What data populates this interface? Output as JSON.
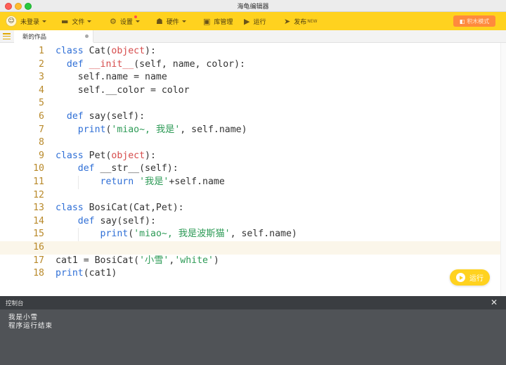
{
  "window": {
    "title": "海龟编辑器"
  },
  "toolbar": {
    "login": "未登录",
    "file": "文件",
    "settings": "设置",
    "hardware": "硬件",
    "library": "库管理",
    "run": "运行",
    "publish": "发布",
    "publish_badge": "NEW",
    "mode": "积木模式"
  },
  "tabs": [
    {
      "label": "新的作品"
    }
  ],
  "editor": {
    "line_numbers": [
      "1",
      "2",
      "3",
      "4",
      "5",
      "6",
      "7",
      "8",
      "9",
      "10",
      "11",
      "12",
      "13",
      "14",
      "15",
      "16",
      "17",
      "18"
    ],
    "active_line": 16,
    "lines": [
      [
        {
          "t": "class ",
          "c": "kw"
        },
        {
          "t": "Cat(",
          "c": ""
        },
        {
          "t": "object",
          "c": "bi"
        },
        {
          "t": "):",
          "c": ""
        }
      ],
      [
        {
          "t": "  ",
          "c": ""
        },
        {
          "t": "def ",
          "c": "kw"
        },
        {
          "t": "__init__",
          "c": "bi"
        },
        {
          "t": "(self, name, color):",
          "c": ""
        }
      ],
      [
        {
          "t": "    self.name = name",
          "c": ""
        }
      ],
      [
        {
          "t": "    self.__color = color",
          "c": ""
        }
      ],
      [],
      [
        {
          "t": "  ",
          "c": ""
        },
        {
          "t": "def ",
          "c": "kw"
        },
        {
          "t": "say(self):",
          "c": ""
        }
      ],
      [
        {
          "t": "    ",
          "c": ""
        },
        {
          "t": "print",
          "c": "kw"
        },
        {
          "t": "(",
          "c": ""
        },
        {
          "t": "'miao~, 我是'",
          "c": "st"
        },
        {
          "t": ", self.name)",
          "c": ""
        }
      ],
      [],
      [
        {
          "t": "class ",
          "c": "kw"
        },
        {
          "t": "Pet(",
          "c": ""
        },
        {
          "t": "object",
          "c": "bi"
        },
        {
          "t": "):",
          "c": ""
        }
      ],
      [
        {
          "t": "    ",
          "c": ""
        },
        {
          "t": "def ",
          "c": "kw"
        },
        {
          "t": "__str__(self):",
          "c": ""
        }
      ],
      [
        {
          "t": "        ",
          "c": ""
        },
        {
          "t": "return ",
          "c": "kw"
        },
        {
          "t": "'我是'",
          "c": "st"
        },
        {
          "t": "+self.name",
          "c": ""
        }
      ],
      [],
      [
        {
          "t": "class ",
          "c": "kw"
        },
        {
          "t": "BosiCat(Cat,Pet):",
          "c": ""
        }
      ],
      [
        {
          "t": "    ",
          "c": ""
        },
        {
          "t": "def ",
          "c": "kw"
        },
        {
          "t": "say(self):",
          "c": ""
        }
      ],
      [
        {
          "t": "        ",
          "c": ""
        },
        {
          "t": "print",
          "c": "kw"
        },
        {
          "t": "(",
          "c": ""
        },
        {
          "t": "'miao~, 我是波斯猫'",
          "c": "st"
        },
        {
          "t": ", self.name)",
          "c": ""
        }
      ],
      [],
      [
        {
          "t": "cat1 = BosiCat(",
          "c": ""
        },
        {
          "t": "'小雪'",
          "c": "st"
        },
        {
          "t": ",",
          "c": ""
        },
        {
          "t": "'white'",
          "c": "st"
        },
        {
          "t": ")",
          "c": ""
        }
      ],
      [
        {
          "t": "print",
          "c": "kw"
        },
        {
          "t": "(cat1)",
          "c": ""
        }
      ]
    ],
    "run_button": "运行"
  },
  "console": {
    "title": "控制台",
    "close_icon": "close-icon",
    "output": [
      "我是小雪",
      "程序运行结束"
    ]
  },
  "colors": {
    "accent": "#ffd21f",
    "mode_button": "#ff8a3d",
    "keyword": "#2f6fd6",
    "builtin": "#d64b4b",
    "string": "#2e9b57",
    "line_number": "#b98a2b"
  }
}
